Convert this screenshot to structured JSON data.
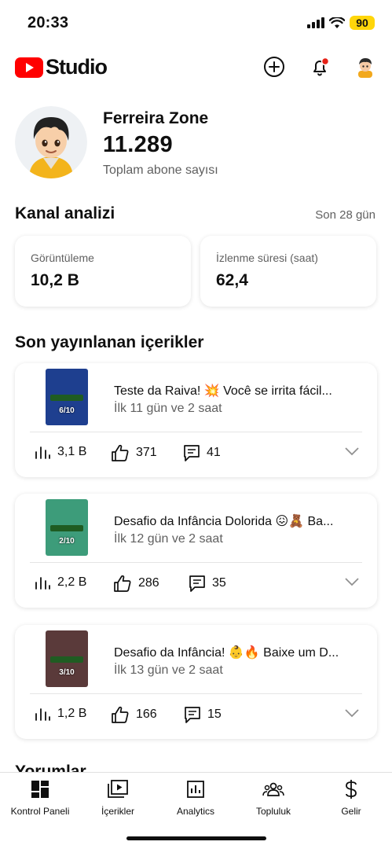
{
  "status_bar": {
    "time": "20:33",
    "battery": "90"
  },
  "header": {
    "logo_text": "Studio",
    "brand_color": "#ff0000"
  },
  "channel": {
    "name": "Ferreira Zone",
    "subscriber_count": "11.289",
    "subscriber_label": "Toplam abone sayısı"
  },
  "analytics": {
    "title": "Kanal analizi",
    "period": "Son 28 gün",
    "metrics": [
      {
        "label": "Görüntüleme",
        "value": "10,2 B"
      },
      {
        "label": "İzlenme süresi (saat)",
        "value": "62,4"
      }
    ]
  },
  "recent": {
    "title": "Son yayınlanan içerikler",
    "videos": [
      {
        "title": "Teste da Raiva! 💥 Você se irrita fácil...",
        "subtitle": "İlk 11 gün ve 2 saat",
        "views": "3,1 B",
        "likes": "371",
        "comments": "41",
        "rank": "6/10",
        "thumb_color": "#1e3f8f"
      },
      {
        "title": "Desafio da Infância Dolorida 😖🧸  Ba...",
        "subtitle": "İlk 12 gün ve 2 saat",
        "views": "2,2 B",
        "likes": "286",
        "comments": "35",
        "rank": "2/10",
        "thumb_color": "#3d9c7a"
      },
      {
        "title": "Desafio da Infância! 👶🔥 Baixe um D...",
        "subtitle": "İlk 13 gün ve 2 saat",
        "views": "1,2 B",
        "likes": "166",
        "comments": "15",
        "rank": "3/10",
        "thumb_color": "#5a3a3a"
      }
    ]
  },
  "next_section_peek": "Yorumlar",
  "nav": [
    {
      "label": "Kontrol Paneli",
      "icon": "dashboard-icon"
    },
    {
      "label": "İçerikler",
      "icon": "content-icon"
    },
    {
      "label": "Analytics",
      "icon": "analytics-icon"
    },
    {
      "label": "Topluluk",
      "icon": "community-icon"
    },
    {
      "label": "Gelir",
      "icon": "earn-icon"
    }
  ]
}
